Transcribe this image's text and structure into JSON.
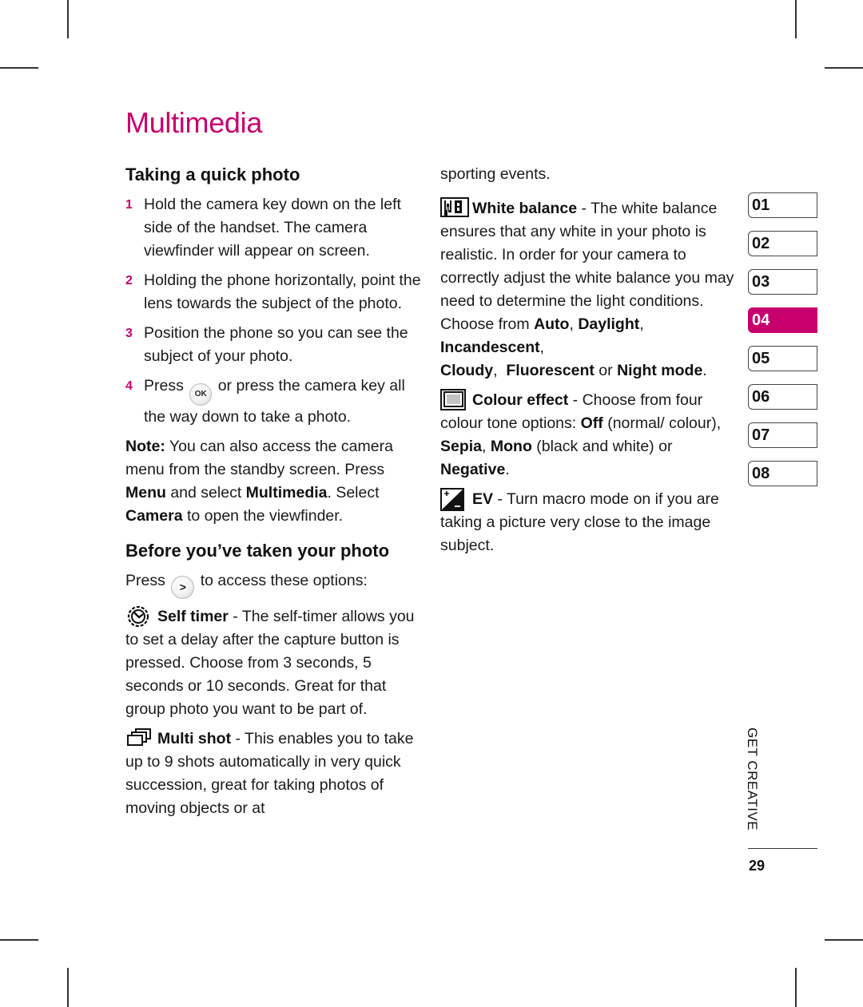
{
  "page": {
    "title": "Multimedia",
    "accent_color": "#c8006e"
  },
  "left": {
    "section1_heading": "Taking a quick photo",
    "steps": [
      {
        "num": "1",
        "text": "Hold the camera key down on the left side of the handset. The camera viewfinder will appear on screen."
      },
      {
        "num": "2",
        "text": "Holding the phone horizontally, point the lens towards the subject of the photo."
      },
      {
        "num": "3",
        "text": "Position the phone so you can see the subject of your photo."
      },
      {
        "num": "4",
        "text_before": "Press",
        "key": "OK",
        "text_after": "or press the camera key all the way down to take a photo."
      }
    ],
    "note": {
      "label": "Note:",
      "t1": " You can also access the camera menu from the standby screen. Press ",
      "b1": "Menu",
      "t2": " and select ",
      "b2": "Multimedia",
      "t3": ". Select ",
      "b3": "Camera",
      "t4": " to open the viewfinder."
    },
    "section2_heading": "Before you’ve taken your photo",
    "press_line": {
      "before": "Press",
      "key": ">",
      "after": "to access these options:"
    },
    "self_timer": {
      "icon": "self-timer-icon",
      "label": "Self timer",
      "text": " - The self-timer allows you to set a delay after the capture button is pressed. Choose from 3 seconds, 5 seconds or 10 seconds. Great for that group photo you want to be part of."
    },
    "multi_shot": {
      "icon": "multi-shot-icon",
      "label": "Multi shot",
      "text": " - This enables you to take up to 9 shots automatically in very quick succession, great for taking photos of moving objects or at"
    }
  },
  "middle": {
    "continuation": "sporting events.",
    "white_balance": {
      "icon": "white-balance-icon",
      "label": "White balance",
      "text": " - The white balance ensures that any white in your photo is realistic. In order for your camera to correctly adjust the white balance you may need to determine the light conditions. Choose from ",
      "opts": [
        "Auto",
        "Daylight",
        "Incandescent",
        "Cloudy",
        "Fluorescent",
        "Night mode"
      ],
      "sep1": ", ",
      "sep2": ", ",
      "sep3": ", ",
      "sep4": ",  ",
      "or": " or ",
      "end": "."
    },
    "colour_effect": {
      "icon": "colour-effect-icon",
      "label": "Colour effect",
      "text": " - Choose from four colour tone options: ",
      "off": "Off",
      "t2": " (normal/ colour), ",
      "sepia": "Sepia",
      "comma": ", ",
      "mono": "Mono",
      "t3": " (black and white) or ",
      "negative": "Negative",
      "end": "."
    },
    "ev": {
      "icon": "ev-icon",
      "label": "EV",
      "text": " - Turn macro mode on if you are taking a picture very close to the image subject."
    }
  },
  "sidebar": {
    "chapters": [
      {
        "label": "01",
        "active": false
      },
      {
        "label": "02",
        "active": false
      },
      {
        "label": "03",
        "active": false
      },
      {
        "label": "04",
        "active": true
      },
      {
        "label": "05",
        "active": false
      },
      {
        "label": "06",
        "active": false
      },
      {
        "label": "07",
        "active": false
      },
      {
        "label": "08",
        "active": false
      }
    ],
    "section_label": "GET CREATIVE",
    "page_number": "29"
  }
}
